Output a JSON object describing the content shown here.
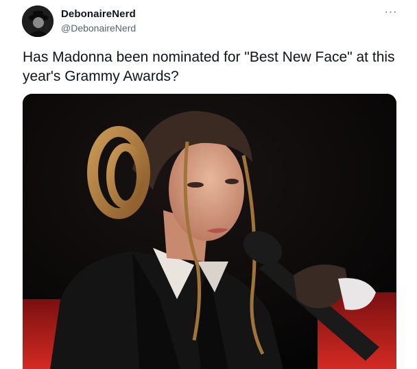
{
  "tweet": {
    "author": {
      "display_name": "DebonaireNerd",
      "handle": "@DebonaireNerd",
      "avatar_icon": "avatar-silhouette"
    },
    "more_icon": "more-options-icon",
    "more_label": "···",
    "text": "Has Madonna been nominated for \"Best New Face\" at this year's Grammy Awards?",
    "media": {
      "kind": "photo",
      "subject": "performer with braided hair holding microphone"
    }
  },
  "colors": {
    "text_primary": "#0f1419",
    "text_secondary": "#536471",
    "background": "#ffffff",
    "stage_red": "#c81e1e"
  }
}
